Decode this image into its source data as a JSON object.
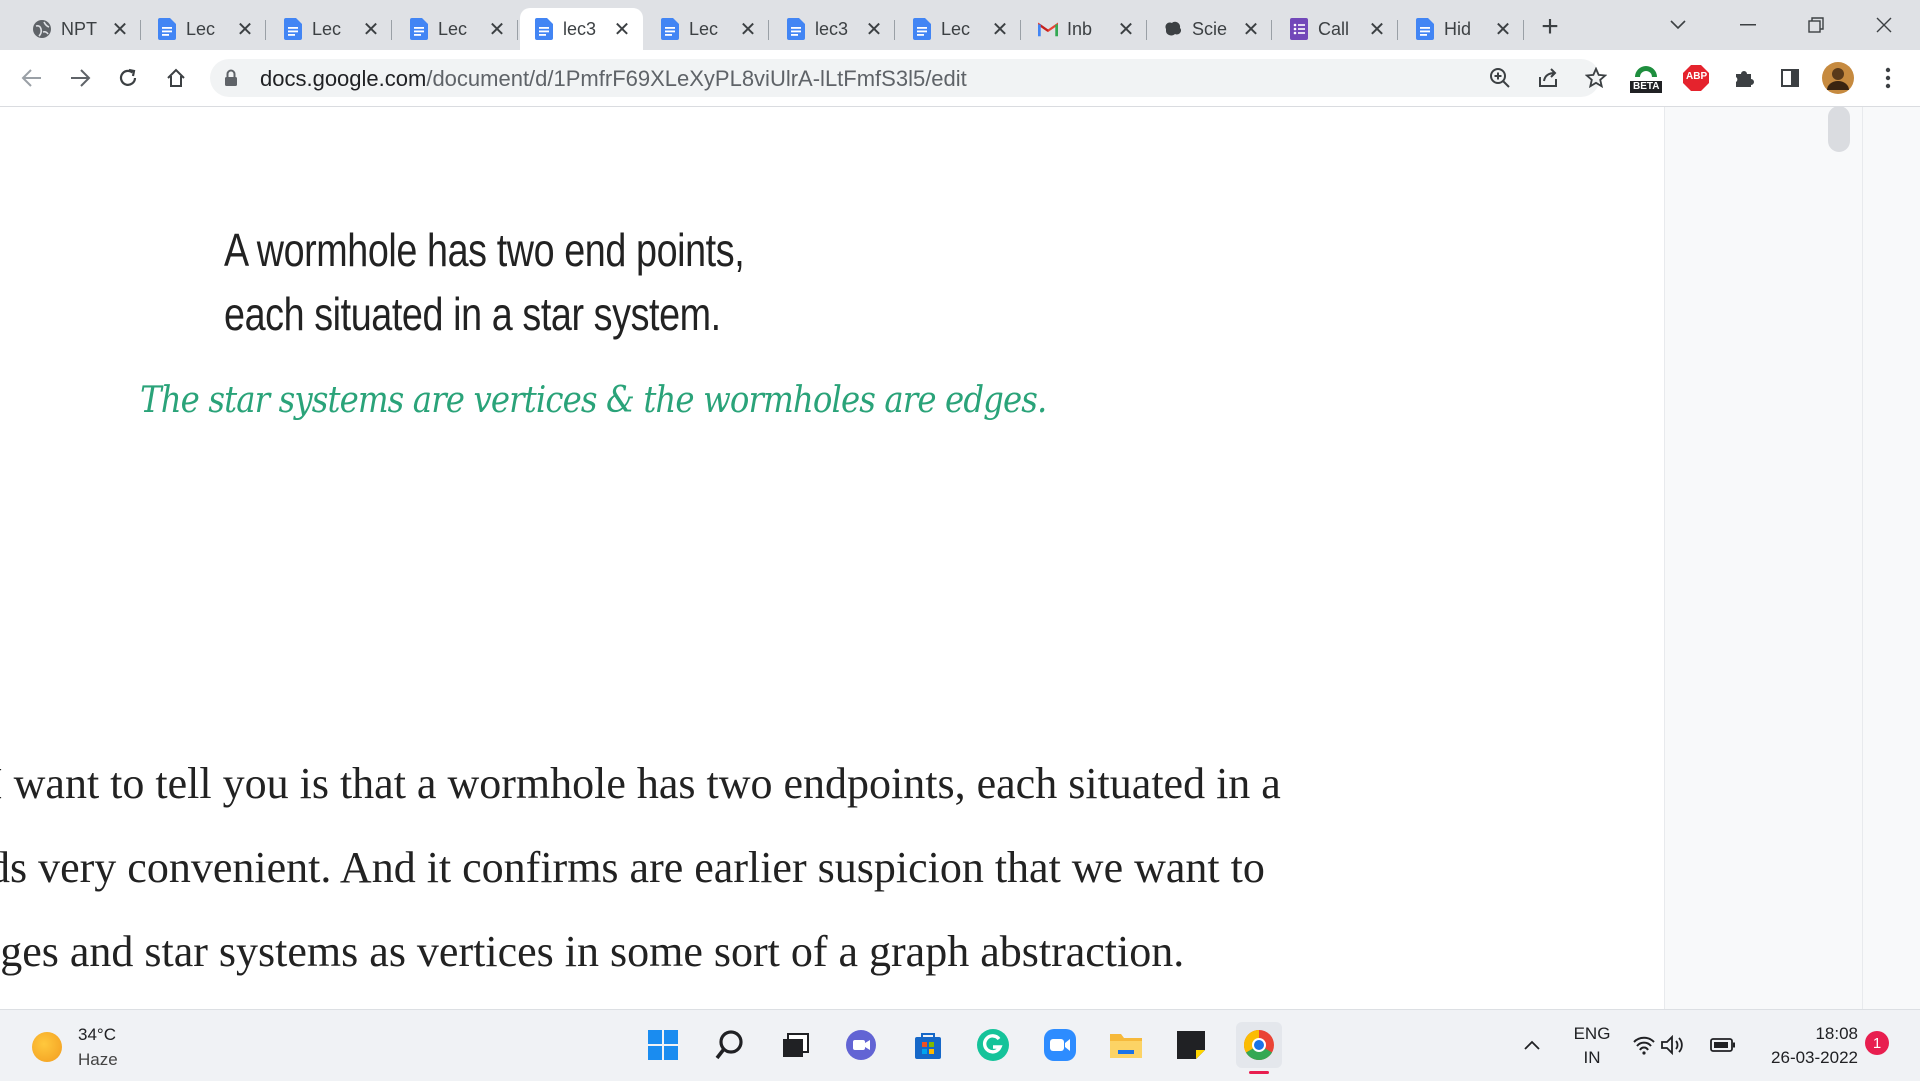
{
  "tabs": [
    {
      "title": "NPT",
      "icon": "globe-icon"
    },
    {
      "title": "Lec",
      "icon": "docs-icon"
    },
    {
      "title": "Lec",
      "icon": "docs-icon"
    },
    {
      "title": "Lec",
      "icon": "docs-icon"
    },
    {
      "title": "lec3",
      "icon": "docs-icon",
      "active": true
    },
    {
      "title": "Lec",
      "icon": "docs-icon"
    },
    {
      "title": "lec3",
      "icon": "docs-icon"
    },
    {
      "title": "Lec",
      "icon": "docs-icon"
    },
    {
      "title": "Inb",
      "icon": "gmail-icon"
    },
    {
      "title": "Scie",
      "icon": "brain-icon"
    },
    {
      "title": "Call",
      "icon": "forms-icon"
    },
    {
      "title": "Hid",
      "icon": "docs-icon"
    }
  ],
  "address_bar": {
    "host": "docs.google.com",
    "path": "/document/d/1PmfrF69XLeXyPL8viUlrA-lLtFmfS3l5/edit"
  },
  "extensions": {
    "beta_label": "BETA",
    "abp_label": "ABP"
  },
  "document": {
    "slide_heading_line1": "A wormhole has two end points,",
    "slide_heading_line2": "each situated in a star system.",
    "slide_script": "The star systems are vertices & the wormholes are edges.",
    "transcript_lines": [
      "I want to tell you is that a wormhole has two endpoints, each situated in a",
      "ds very convenient. And it confirms are earlier suspicion that we want to",
      "lges and star systems as vertices in some sort of a graph abstraction."
    ]
  },
  "taskbar": {
    "weather_temp": "34°C",
    "weather_condition": "Haze",
    "language_line1": "ENG",
    "language_line2": "IN",
    "time": "18:08",
    "date": "26-03-2022",
    "notification_count": "1"
  },
  "colors": {
    "docs_blue": "#4285f4",
    "script_green": "#2aa379",
    "tab_strip": "#dfe1e5"
  }
}
